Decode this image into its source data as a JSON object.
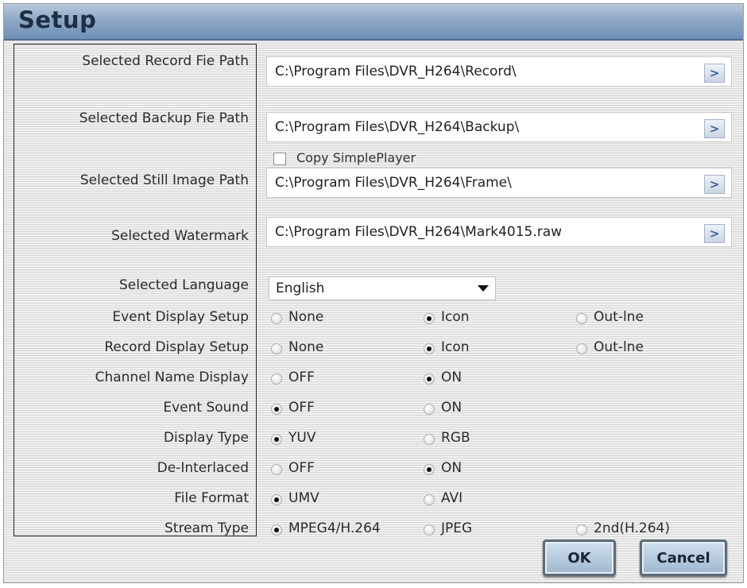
{
  "window": {
    "title": "Setup"
  },
  "paths": [
    {
      "label": "Selected Record Fie Path",
      "value": "C:\\Program Files\\DVR_H264\\Record\\",
      "browse_icon": ">"
    },
    {
      "label": "Selected Backup Fie Path",
      "value": "C:\\Program Files\\DVR_H264\\Backup\\",
      "browse_icon": ">"
    },
    {
      "label": "Selected Still Image Path",
      "value": "C:\\Program Files\\DVR_H264\\Frame\\",
      "browse_icon": ">"
    },
    {
      "label": "Selected Watermark",
      "value": "C:\\Program Files\\DVR_H264\\Mark4015.raw",
      "browse_icon": ">"
    }
  ],
  "copy_simpleplayer": {
    "label": "Copy SimplePlayer",
    "checked": false
  },
  "language": {
    "label": "Selected Language",
    "value": "English"
  },
  "options": [
    {
      "label": "Event Display Setup",
      "choices": [
        "None",
        "Icon",
        "Out-lne"
      ],
      "selected": 1
    },
    {
      "label": "Record Display Setup",
      "choices": [
        "None",
        "Icon",
        "Out-lne"
      ],
      "selected": 1
    },
    {
      "label": "Channel Name Display",
      "choices": [
        "OFF",
        "ON"
      ],
      "selected": 1
    },
    {
      "label": "Event Sound",
      "choices": [
        "OFF",
        "ON"
      ],
      "selected": 0
    },
    {
      "label": "Display Type",
      "choices": [
        "YUV",
        "RGB"
      ],
      "selected": 0
    },
    {
      "label": "De-Interlaced",
      "choices": [
        "OFF",
        "ON"
      ],
      "selected": 1
    },
    {
      "label": "File Format",
      "choices": [
        "UMV",
        "AVI"
      ],
      "selected": 0
    },
    {
      "label": "Stream Type",
      "choices": [
        "MPEG4/H.264",
        "JPEG",
        "2nd(H.264)"
      ],
      "selected": 0
    }
  ],
  "buttons": {
    "ok": "OK",
    "cancel": "Cancel"
  }
}
